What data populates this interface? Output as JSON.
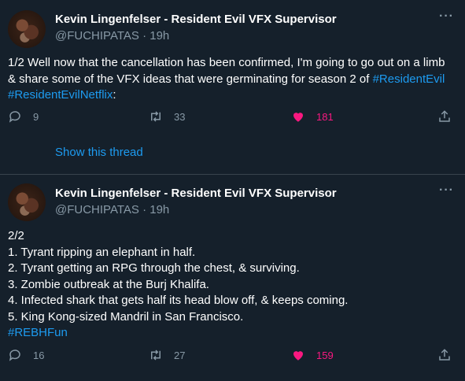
{
  "tweets": [
    {
      "author_name": "Kevin Lingenfelser - Resident Evil VFX Supervisor",
      "handle_time": "@FUCHIPATAS · 19h",
      "text_plain": "1/2 Well now that the cancellation has been confirmed, I'm going to go out on a limb & share some of the VFX ideas that were germinating for season 2 of ",
      "hashtag1": "#ResidentEvil",
      "hashtag2": "#ResidentEvilNetflix",
      "text_end": ":",
      "replies": "9",
      "retweets": "33",
      "likes": "181",
      "show_thread": "Show this thread"
    },
    {
      "author_name": "Kevin Lingenfelser - Resident Evil VFX Supervisor",
      "handle_time": "@FUCHIPATAS · 19h",
      "lines": [
        "2/2",
        "1. Tyrant ripping an elephant in half.",
        "2. Tyrant getting an RPG through the chest, & surviving.",
        "3. Zombie outbreak at the Burj Khalifa.",
        "4. Infected shark that gets half its head blow off, & keeps coming.",
        "5. King Kong-sized Mandril in San Francisco."
      ],
      "hashtag": "#REBHFun",
      "replies": "16",
      "retweets": "27",
      "likes": "159"
    }
  ],
  "icons": {
    "more": "···",
    "reply": "reply-icon",
    "retweet": "retweet-icon",
    "like": "heart-filled-icon",
    "share": "share-icon"
  },
  "colors": {
    "background": "#15202b",
    "link": "#1d9bf0",
    "muted": "#8899a6",
    "like": "#f91880",
    "divider": "#38444d"
  }
}
